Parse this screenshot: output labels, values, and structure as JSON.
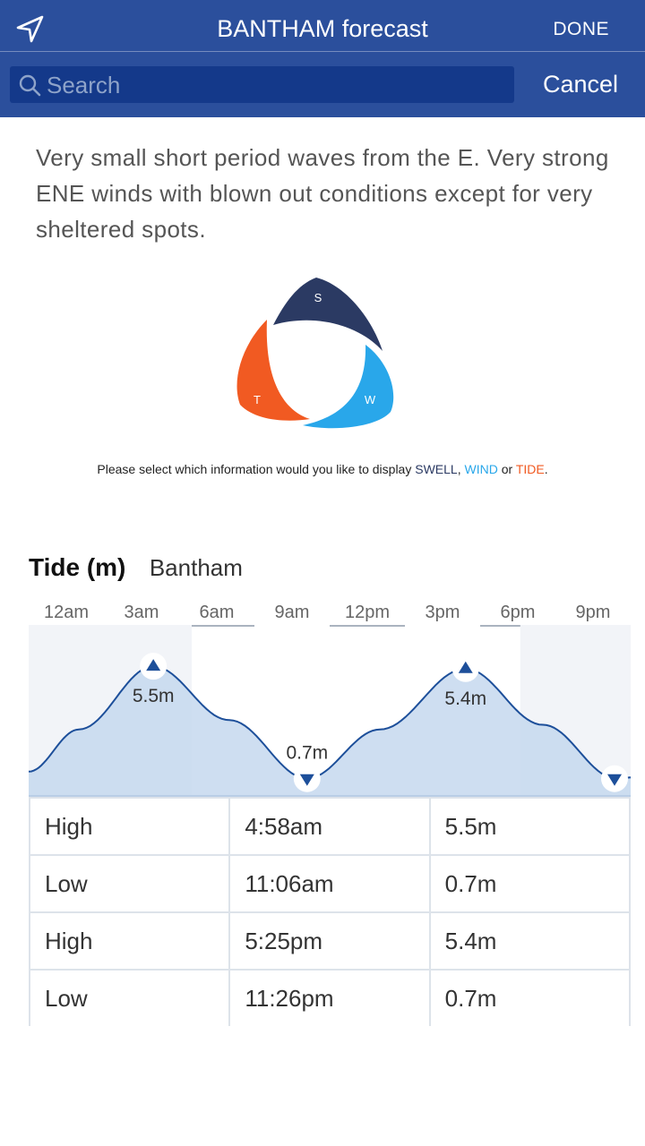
{
  "header": {
    "title": "BANTHAM forecast",
    "done_label": "DONE",
    "cancel_label": "Cancel",
    "search_placeholder": "Search"
  },
  "description": "Very small short period waves from the E. Very strong ENE winds with blown out conditions except for very sheltered spots.",
  "selector": {
    "swell_letter": "S",
    "wind_letter": "W",
    "tide_letter": "T",
    "colors": {
      "swell": "#2b3a63",
      "wind": "#29a7ea",
      "tide": "#f15a22"
    },
    "hint_prefix": "Please select which information would you like to display ",
    "hint_swell": "SWELL",
    "hint_sep1": ", ",
    "hint_wind": "WIND",
    "hint_sep2": " or ",
    "hint_tide": "TIDE",
    "hint_end": "."
  },
  "tide": {
    "title": "Tide (m)",
    "location": "Bantham",
    "time_labels": [
      "12am",
      "3am",
      "6am",
      "9am",
      "12pm",
      "3pm",
      "6pm",
      "9pm"
    ],
    "table": [
      {
        "type": "High",
        "time": "4:58am",
        "height": "5.5m"
      },
      {
        "type": "Low",
        "time": "11:06am",
        "height": "0.7m"
      },
      {
        "type": "High",
        "time": "5:25pm",
        "height": "5.4m"
      },
      {
        "type": "Low",
        "time": "11:26pm",
        "height": "0.7m"
      }
    ]
  },
  "chart_data": {
    "type": "area",
    "title": "Tide (m)",
    "x_unit": "hours",
    "xlim": [
      0,
      24
    ],
    "ylim": [
      0,
      6.5
    ],
    "x": [
      0,
      2,
      4.97,
      8,
      11.1,
      14,
      17.42,
      20.5,
      23.43,
      24
    ],
    "y": [
      1.0,
      2.8,
      5.5,
      3.2,
      0.7,
      2.8,
      5.4,
      3.0,
      0.7,
      0.75
    ],
    "extremes": [
      {
        "x": 4.97,
        "y": 5.5,
        "label": "5.5m",
        "kind": "high"
      },
      {
        "x": 11.1,
        "y": 0.7,
        "label": "0.7m",
        "kind": "low"
      },
      {
        "x": 17.42,
        "y": 5.4,
        "label": "5.4m",
        "kind": "high"
      },
      {
        "x": 23.43,
        "y": 0.7,
        "label": "",
        "kind": "low"
      }
    ],
    "night_shade": [
      [
        0,
        6.5
      ],
      [
        19.6,
        24
      ]
    ],
    "colors": {
      "line": "#1d4f9a",
      "fill": "#c5d8ee",
      "night": "#f2f4f8"
    }
  }
}
